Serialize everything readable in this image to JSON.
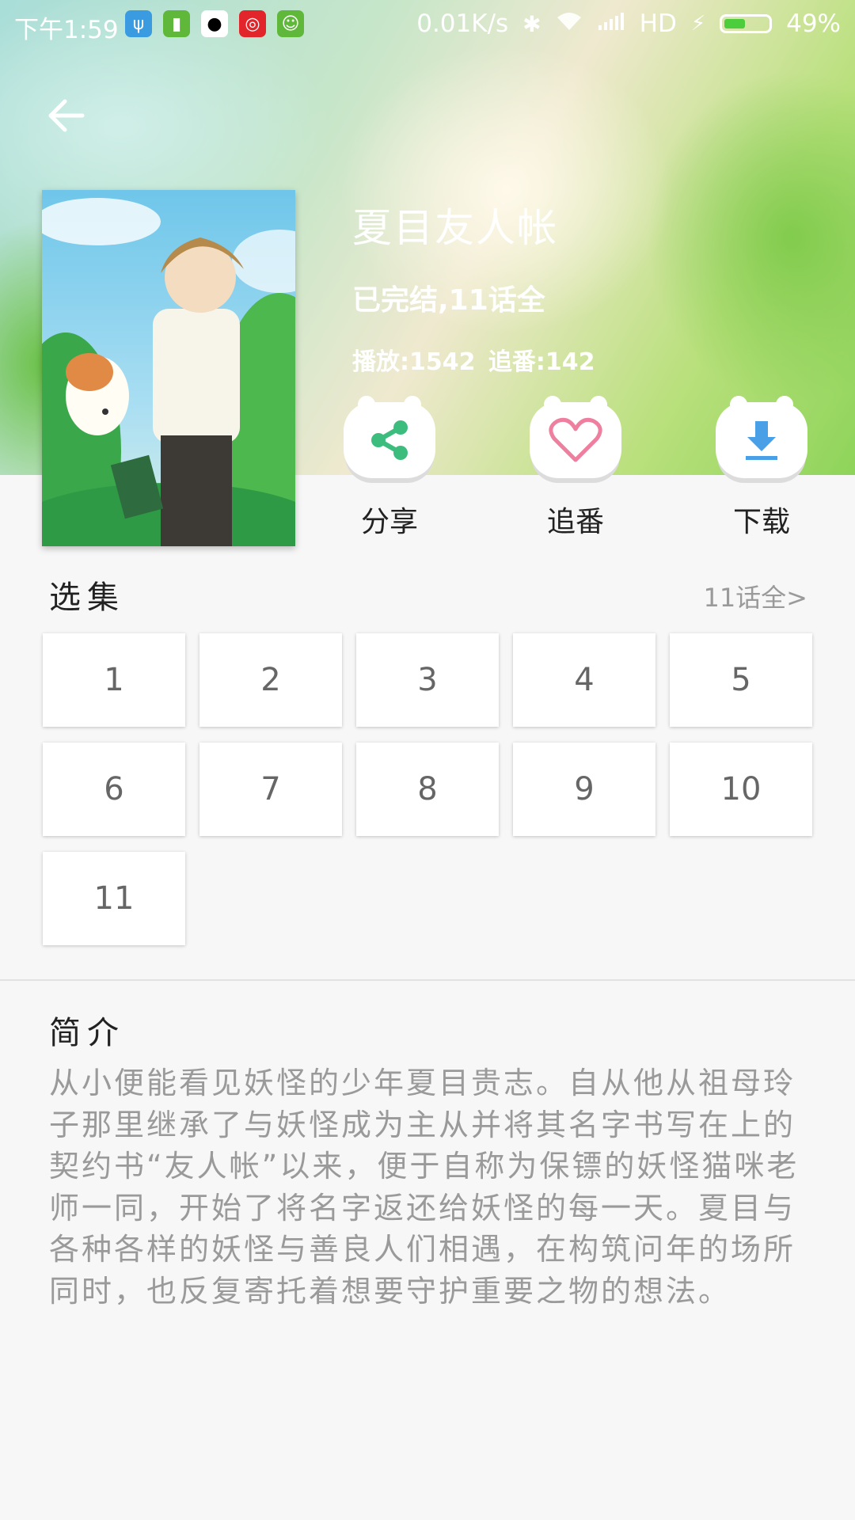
{
  "status_bar": {
    "time": "下午1:59",
    "network_speed": "0.01K/s",
    "network_type": "HD",
    "battery_percent": "49%",
    "battery_level": 0.49
  },
  "anime": {
    "title": "夏目友人帐",
    "status": "已完结,11话全",
    "stats": "播放:1542  追番:142"
  },
  "actions": [
    {
      "label": "分享",
      "icon": "share-icon",
      "color": "#3dbd7d"
    },
    {
      "label": "追番",
      "icon": "heart-icon",
      "color": "#ef7f9f"
    },
    {
      "label": "下载",
      "icon": "download-icon",
      "color": "#4aa0e6"
    }
  ],
  "episodes": {
    "title": "选集",
    "more": "11话全>",
    "items": [
      "1",
      "2",
      "3",
      "4",
      "5",
      "6",
      "7",
      "8",
      "9",
      "10",
      "11"
    ]
  },
  "intro": {
    "title": "简介",
    "text": "从小便能看见妖怪的少年夏目贵志。自从他从祖母玲子那里继承了与妖怪成为主从并将其名字书写在上的契约书“友人帐”以来，便于自称为保镖的妖怪猫咪老师一同，开始了将名字返还给妖怪的每一天。夏目与各种各样的妖怪与善良人们相遇，在构筑问年的场所同时，也反复寄托着想要守护重要之物的想法。"
  }
}
